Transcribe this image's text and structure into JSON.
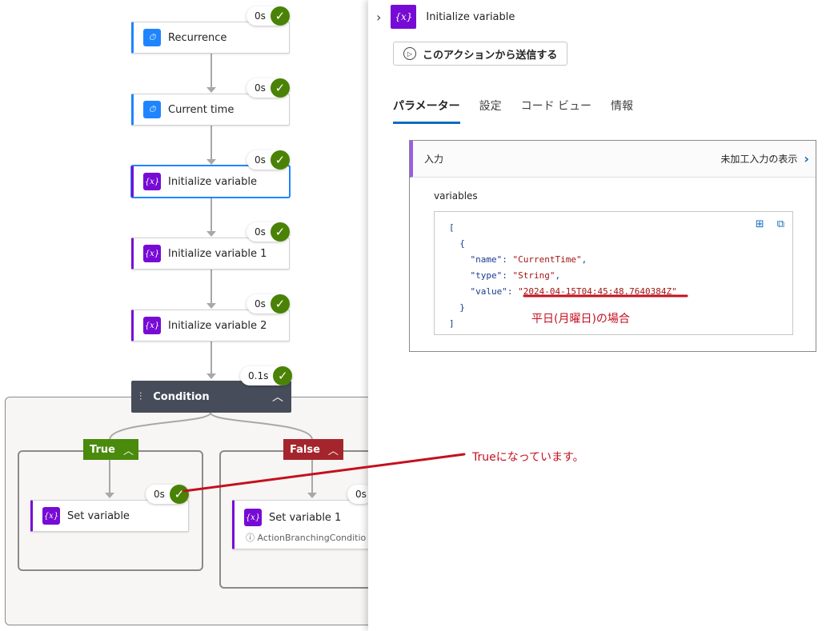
{
  "flow": {
    "recurrence": {
      "label": "Recurrence",
      "duration": "0s"
    },
    "current_time": {
      "label": "Current time",
      "duration": "0s"
    },
    "init_var": {
      "label": "Initialize variable",
      "duration": "0s"
    },
    "init_var1": {
      "label": "Initialize variable 1",
      "duration": "0s"
    },
    "init_var2": {
      "label": "Initialize variable 2",
      "duration": "0s"
    },
    "condition": {
      "label": "Condition",
      "duration": "0.1s"
    },
    "true_branch": {
      "label": "True",
      "color": "#4a8a0c"
    },
    "false_branch": {
      "label": "False",
      "color": "#a4262c"
    },
    "set_var": {
      "label": "Set variable",
      "duration": "0s"
    },
    "set_var1": {
      "label": "Set variable 1",
      "duration": "0s",
      "sub": "ActionBranchingConditio"
    }
  },
  "panel": {
    "title": "Initialize variable",
    "send_button": "このアクションから送信する",
    "tabs": [
      "パラメーター",
      "設定",
      "コード ビュー",
      "情報"
    ],
    "section_title": "入力",
    "raw_link": "未加工入力の表示",
    "variables_label": "variables",
    "code": {
      "open_bracket": "[",
      "open_brace": "{",
      "name_line_key": "\"name\": ",
      "name_value": "\"CurrentTime\"",
      "type_line_key": "\"type\": ",
      "type_value": "\"String\"",
      "value_line_key": "\"value\": ",
      "value_value": "\"2024-04-15T04:45:48.7640384Z\"",
      "close_brace": "}",
      "close_bracket": "]"
    }
  },
  "annotations": {
    "weekday_note": "平日(月曜日)の場合",
    "true_note": "Trueになっています。",
    "color": "#c50f1f"
  },
  "icons": {
    "clock": "clock-icon",
    "variable": "variable-icon",
    "check": "check-icon",
    "condition": "condition-icon",
    "chevron_right": "chevron-right-icon",
    "play": "play-icon",
    "table": "table-icon",
    "copy": "copy-icon",
    "info": "info-icon"
  }
}
